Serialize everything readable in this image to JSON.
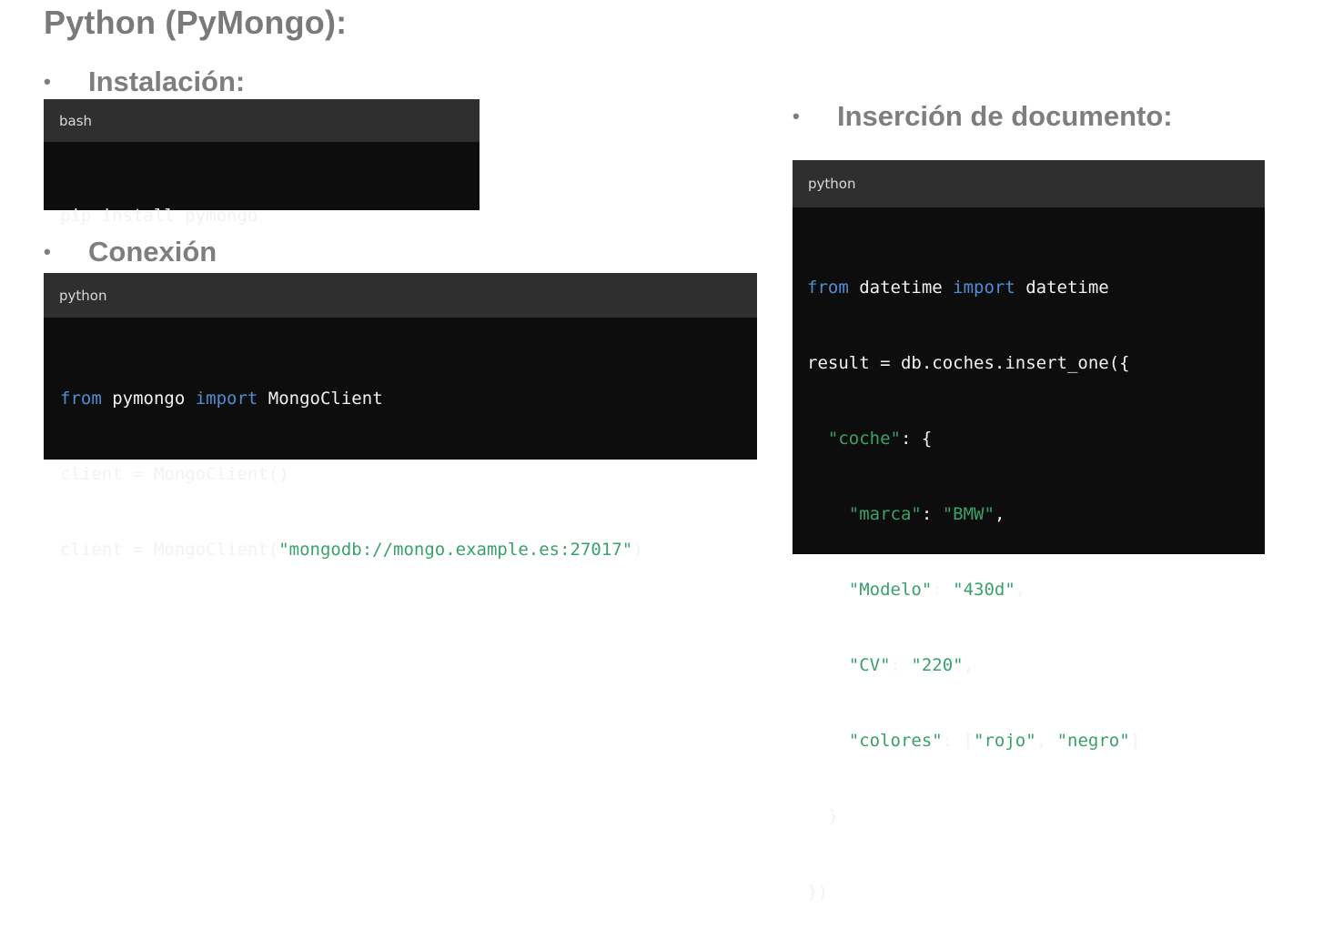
{
  "title": "Python (PyMongo):",
  "sections": {
    "install": {
      "bullet": "•",
      "label": "Instalación:",
      "lang": "bash",
      "code": "pip install pymongo"
    },
    "connect": {
      "bullet": "•",
      "label": "Conexión",
      "lang": "python",
      "line1": {
        "kw1": "from",
        "a": " pymongo ",
        "kw2": "import",
        "b": " MongoClient"
      },
      "line2": "client = MongoClient()",
      "line3": {
        "a": "client = MongoClient(",
        "s": "\"mongodb://mongo.example.es:27017\"",
        "b": ")"
      }
    },
    "insert": {
      "bullet": "•",
      "label": "Inserción de documento:",
      "lang": "python",
      "line1": {
        "kw1": "from",
        "a": " datetime ",
        "kw2": "import",
        "b": " datetime"
      },
      "line2": "result = db.coches.insert_one({",
      "line3": {
        "indent": "  ",
        "s": "\"coche\"",
        "b": ": {"
      },
      "line4": {
        "indent": "    ",
        "s1": "\"marca\"",
        "sep": ": ",
        "s2": "\"BMW\"",
        "b": ","
      },
      "line5": {
        "indent": "    ",
        "s1": "\"Modelo\"",
        "sep": ": ",
        "s2": "\"430d\"",
        "b": ","
      },
      "line6": {
        "indent": "    ",
        "s1": "\"CV\"",
        "sep": ": ",
        "s2": "\"220\"",
        "b": ","
      },
      "line7": {
        "indent": "    ",
        "s1": "\"colores\"",
        "sep": ": [",
        "s2": "\"rojo\"",
        "sep2": ", ",
        "s3": "\"negro\"",
        "b": "]"
      },
      "line8": "  }",
      "line9": "})"
    }
  }
}
